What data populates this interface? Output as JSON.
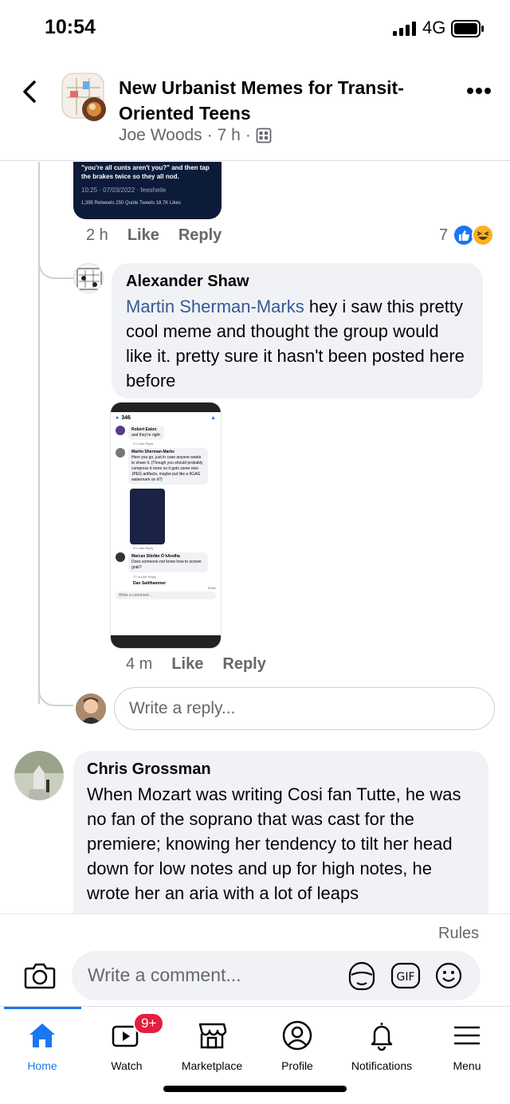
{
  "status": {
    "time": "10:54",
    "network": "4G"
  },
  "header": {
    "title": "New Urbanist Memes for Transit-Oriented Teens",
    "author": "Joe Woods",
    "age": "7 h"
  },
  "top_screenshot": {
    "quote": "\"you're all cunts aren't you?\" and then tap the brakes twice so they all nod.",
    "date": "10:25 · 07/03/2022 · feesheile",
    "stats": "1,395 Retweets  250 Quote Tweets  18.7K Likes"
  },
  "comment1_actions": {
    "time": "2 h",
    "like": "Like",
    "reply": "Reply",
    "reaction_count": "7"
  },
  "comment2": {
    "author": "Alexander Shaw",
    "mention": "Martin Sherman-Marks",
    "text": " hey i saw this pretty cool meme and thought the group would like it. pretty sure it hasn't been posted here before",
    "time": "4 m",
    "like": "Like",
    "reply": "Reply"
  },
  "nested_screenshot": {
    "count": "346",
    "c1_author": "Robert Eaton",
    "c1_text": "and they're right.",
    "c1_meta": "2 h   Like   Reply",
    "c2_author": "Martin Sherman-Marks",
    "c2_text": "Here you go, just in case anyone wants to share it. (Though you should probably compress it more so it gets some nice JPEG artifacts, maybe put like a 9GAG watermark on it?)",
    "c2_meta": "2 h   Like   Reply",
    "c3_author": "Marcas Stiofán Ó hAodha",
    "c3_text": "Does someone not know how to screen grab?",
    "c3_meta": "17 m   Like   Reply",
    "c4_author": "Dan Sattlhammer",
    "rules": "Rules",
    "write": "Write a comment..."
  },
  "reply_input": {
    "placeholder": "Write a reply..."
  },
  "comment3": {
    "author": "Chris Grossman",
    "text": "When Mozart was writing Cosi fan Tutte, he was no fan of the soprano that was cast for the premiere; knowing her tendency to tilt her head down for low notes and up for high notes, he wrote her an aria with a lot of leaps"
  },
  "rules": "Rules",
  "comment_input": {
    "placeholder": "Write a comment..."
  },
  "tabs": [
    {
      "label": "Home",
      "icon": "home-icon"
    },
    {
      "label": "Watch",
      "icon": "video-icon"
    },
    {
      "label": "Marketplace",
      "icon": "shop-icon"
    },
    {
      "label": "Profile",
      "icon": "profile-icon"
    },
    {
      "label": "Notifications",
      "icon": "bell-icon"
    },
    {
      "label": "Menu",
      "icon": "menu-icon"
    }
  ],
  "watch_badge": "9+",
  "colors": {
    "accent": "#1877f2",
    "mention": "#385898",
    "badge": "#e41e3f",
    "bubble": "#f0f2f5"
  }
}
